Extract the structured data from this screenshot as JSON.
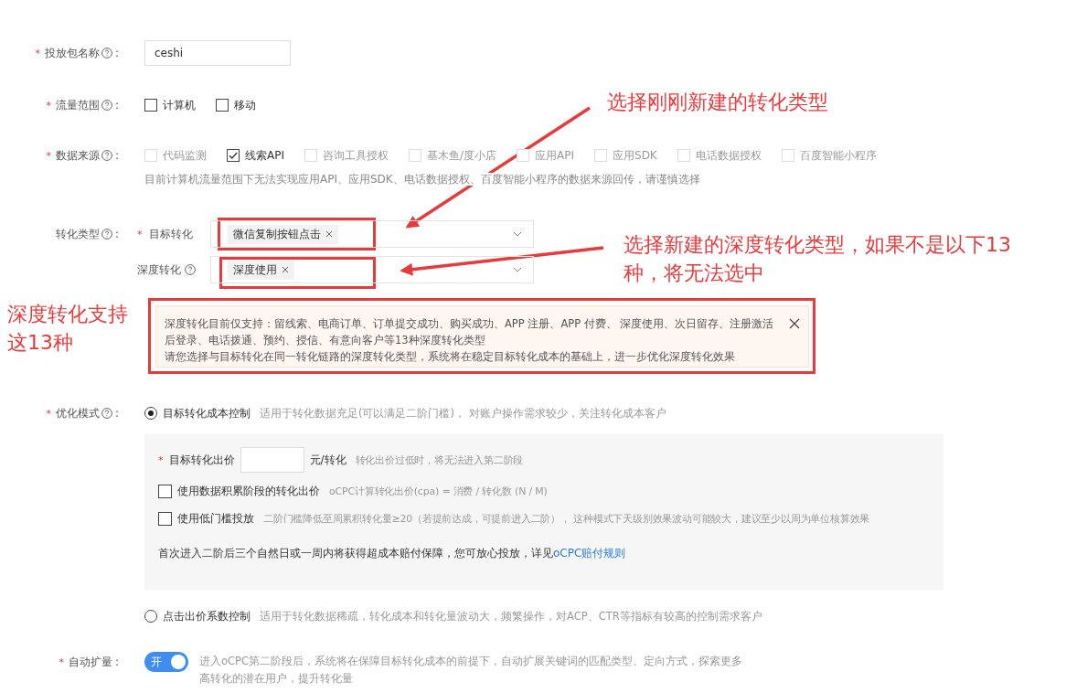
{
  "form": {
    "package_name": {
      "label": "投放包名称",
      "colon": ":",
      "required_mark": "*",
      "help": true,
      "value": "ceshi"
    },
    "traffic_scope": {
      "label": "流量范围",
      "colon": ":",
      "required_mark": "*",
      "help": true,
      "options": [
        {
          "label": "计算机",
          "checked": false,
          "disabled": false
        },
        {
          "label": "移动",
          "checked": false,
          "disabled": false
        }
      ]
    },
    "data_source": {
      "label": "数据来源",
      "colon": ":",
      "required_mark": "*",
      "help": true,
      "options": [
        {
          "label": "代码监测",
          "checked": false,
          "disabled": true
        },
        {
          "label": "线索API",
          "checked": true,
          "disabled": false
        },
        {
          "label": "咨询工具授权",
          "checked": false,
          "disabled": true
        },
        {
          "label": "基木鱼/度小店",
          "checked": false,
          "disabled": true
        },
        {
          "label": "应用API",
          "checked": false,
          "disabled": true
        },
        {
          "label": "应用SDK",
          "checked": false,
          "disabled": true
        },
        {
          "label": "电话数据授权",
          "checked": false,
          "disabled": true
        },
        {
          "label": "百度智能小程序",
          "checked": false,
          "disabled": true
        }
      ],
      "hint": "目前计算机流量范围下无法实现应用API、应用SDK、电话数据授权、百度智能小程序的数据来源回传，请谨慎选择"
    },
    "conversion_type": {
      "label": "转化类型",
      "colon": ":",
      "help": true,
      "selects": [
        {
          "label": "目标转化",
          "required_mark": "*",
          "help": false,
          "tags": [
            "微信复制按钮点击"
          ]
        },
        {
          "label": "深度转化",
          "help": true,
          "tags": [
            "深度使用"
          ]
        }
      ],
      "alert": {
        "lines": [
          "深度转化目前仅支持：留线索、电商订单、订单提交成功、购买成功、APP 注册、APP 付费、 深度使用、次日留存、注册激活后登录、电话拨通、预约、授信、有意向客户等13种深度转化类型",
          "请您选择与目标转化在同一转化链路的深度转化类型，系统将在稳定目标转化成本的基础上，进一步优化深度转化效果"
        ],
        "closable": true
      }
    },
    "optimization_mode": {
      "label": "优化模式",
      "colon": ":",
      "required_mark": "*",
      "help": true,
      "options": [
        {
          "label": "目标转化成本控制",
          "description": "适用于转化数据充足(可以满足二阶门槛)， 对账户操作需求较少，关注转化成本客户",
          "selected": true,
          "panel": {
            "bid": {
              "label": "目标转化出价",
              "required_mark": "*",
              "unit": "元/转化",
              "hint": "转化出价过低时，将无法进入第二阶段"
            },
            "checkboxes": [
              {
                "label": "使用数据积累阶段的转化出价",
                "hint": "oCPC计算转化出价(cpa) = 消费 / 转化数 (N / M)",
                "checked": false
              },
              {
                "label": "使用低门槛投放",
                "hint": "二阶门槛降低至周累积转化量≥20（若提前达成，可提前进入二阶）， 这种模式下天级别效果波动可能较大，建议至少以周为单位核算效果",
                "checked": false
              }
            ],
            "note": "首次进入二阶后三个自然日或一周内将获得超成本赔付保障，您可放心投放，详见",
            "link": "oCPC赔付规则"
          }
        },
        {
          "label": "点击出价系数控制",
          "description": "适用于转化数据稀疏，转化成本和转化量波动大，频繁操作，对ACP、CTR等指标有较高的控制需求客户",
          "selected": false
        }
      ]
    },
    "auto_expand": {
      "label": "自动扩量",
      "colon": ":",
      "required_mark": "*",
      "help": false,
      "on": true,
      "switch_text": "开",
      "description": "进入oCPC第二阶段后，系统将在保障目标转化成本的前提下，自动扩展关键词的匹配类型、定向方式，探索更多高转化的潜在用户，提升转化量"
    }
  },
  "annotations": [
    {
      "text": "选择刚刚新建的转化类型"
    },
    {
      "text": "选择新建的深度转化类型，如果不是以下13种，将无法选中"
    },
    {
      "text": "深度转化支持这13种"
    }
  ]
}
